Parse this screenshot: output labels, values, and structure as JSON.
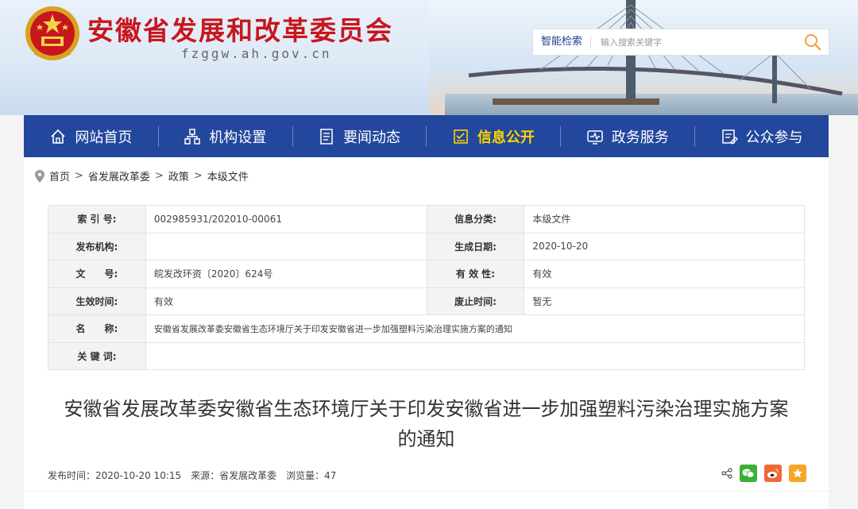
{
  "header": {
    "site_title": "安徽省发展和改革委员会",
    "domain": "fzggw.ah.gov.cn",
    "search_label": "智能检索",
    "search_placeholder": "输入搜索关键字"
  },
  "nav": {
    "items": [
      {
        "label": "网站首页",
        "icon": "home-icon"
      },
      {
        "label": "机构设置",
        "icon": "org-chart-icon"
      },
      {
        "label": "要闻动态",
        "icon": "news-icon"
      },
      {
        "label": "信息公开",
        "icon": "info-open-icon",
        "active": true
      },
      {
        "label": "政务服务",
        "icon": "service-icon"
      },
      {
        "label": "公众参与",
        "icon": "participate-icon"
      }
    ]
  },
  "breadcrumb": [
    "首页",
    "省发展改革委",
    "政策",
    "本级文件"
  ],
  "meta": {
    "index_no_label": "索 引 号:",
    "index_no": "002985931/202010-00061",
    "category_label": "信息分类:",
    "category": "本级文件",
    "publisher_label": "发布机构:",
    "publisher": "",
    "created_label": "生成日期:",
    "created": "2020-10-20",
    "doc_no_label": "文　　号:",
    "doc_no": "皖发改环资〔2020〕624号",
    "validity_label": "有 效 性:",
    "validity": "有效",
    "effective_label": "生效时间:",
    "effective": "有效",
    "abolished_label": "废止时间:",
    "abolished": "暂无",
    "name_label": "名　　称:",
    "name": "安徽省发展改革委安徽省生态环境厅关于印发安徽省进一步加强塑料污染治理实施方案的通知",
    "keywords_label": "关 键 词:",
    "keywords": ""
  },
  "doc": {
    "title": "安徽省发展改革委安徽省生态环境厅关于印发安徽省进一步加强塑料污染治理实施方案的通知",
    "pub_time": "发布时间：2020-10-20 10:15",
    "source": "来源：省发展改革委",
    "views": "浏览量：47"
  },
  "colors": {
    "nav_bg": "#23479d",
    "title_red": "#c8161d",
    "active_yellow": "#ffd400"
  }
}
